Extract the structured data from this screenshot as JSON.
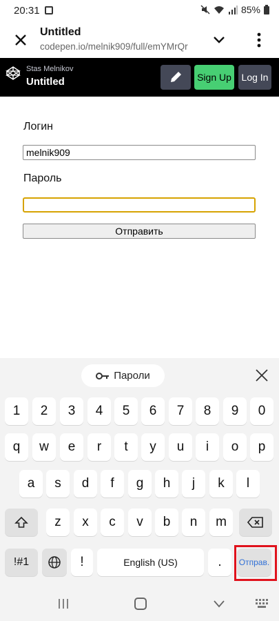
{
  "status": {
    "time": "20:31",
    "battery": "85%"
  },
  "browser": {
    "title": "Untitled",
    "url": "codepen.io/melnik909/full/emYMrQr"
  },
  "codepen": {
    "author": "Stas Melnikov",
    "title": "Untitled",
    "signup_label": "Sign Up",
    "login_label": "Log In",
    "signup_color": "#47cf73"
  },
  "form": {
    "login_label": "Логин",
    "login_value": "melnik909",
    "password_label": "Пароль",
    "password_value": "",
    "submit_label": "Отправить"
  },
  "keyboard": {
    "suggestion_label": "Пароли",
    "row_numbers": [
      "1",
      "2",
      "3",
      "4",
      "5",
      "6",
      "7",
      "8",
      "9",
      "0"
    ],
    "row_1": [
      "q",
      "w",
      "e",
      "r",
      "t",
      "y",
      "u",
      "i",
      "o",
      "p"
    ],
    "row_2": [
      "a",
      "s",
      "d",
      "f",
      "g",
      "h",
      "j",
      "k",
      "l"
    ],
    "row_3": [
      "z",
      "x",
      "c",
      "v",
      "b",
      "n",
      "m"
    ],
    "symbols_label": "!#1",
    "exclaim_label": "!",
    "space_label": "English (US)",
    "period_label": ".",
    "send_label": "Отправ.",
    "highlight_color": "#e0121c"
  }
}
